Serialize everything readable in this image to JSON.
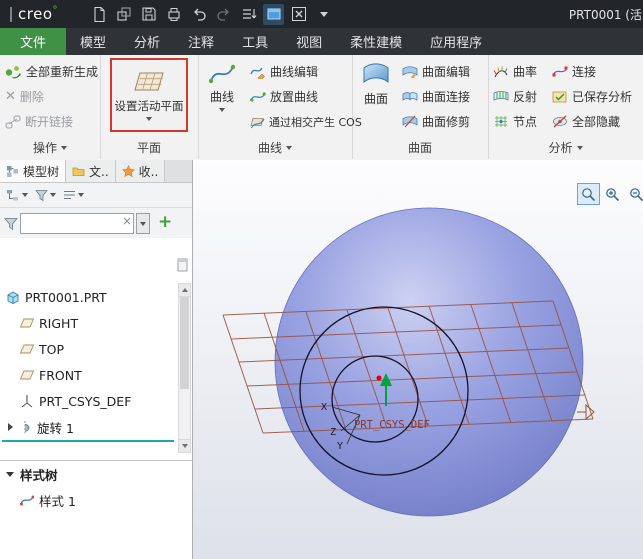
{
  "titlebar": {
    "logo": "creo",
    "logo_mark": "°",
    "window_title": "PRT0001 (活"
  },
  "tabs": [
    "文件",
    "模型",
    "分析",
    "注释",
    "工具",
    "视图",
    "柔性建模",
    "应用程序"
  ],
  "ribbon": {
    "operations": {
      "label": "操作",
      "regenerate_all": "全部重新生成",
      "delete": "删除",
      "break_link": "断开链接"
    },
    "plane": {
      "label": "平面",
      "set_active_plane": "设置活动平面"
    },
    "curve": {
      "label": "曲线",
      "button": "曲线",
      "edit": "曲线编辑",
      "place": "放置曲线",
      "cos": "通过相交产生 COS"
    },
    "surface": {
      "label": "曲面",
      "button": "曲面",
      "edit": "曲面编辑",
      "connect": "曲面连接",
      "trim": "曲面修剪"
    },
    "analysis": {
      "label": "分析",
      "curvature": "曲率",
      "reflection": "反射",
      "node": "节点",
      "connect": "连接",
      "saved": "已保存分析",
      "hide_all": "全部隐藏"
    }
  },
  "panel": {
    "tabs": [
      "模型树",
      "文..",
      "收.."
    ],
    "filter": {
      "value": ""
    },
    "tree": [
      "PRT0001.PRT",
      "RIGHT",
      "TOP",
      "FRONT",
      "PRT_CSYS_DEF",
      "旋转 1"
    ],
    "style_tree": {
      "header": "样式树",
      "item": "样式 1"
    }
  },
  "viewport": {
    "x_label": "X",
    "y_label": "Y",
    "z_label": "Z",
    "csys_label": "PRT_CSYS_DEF"
  },
  "glyphs": {
    "delete_x": "✕",
    "clear_x": "×",
    "plus": "+"
  },
  "colors": {
    "accent_green": "#3f9245",
    "highlight_red": "#cf3a2a",
    "sphere": "#8f98d8",
    "grid": "#97503e",
    "select_teal": "#1aa7b0"
  }
}
